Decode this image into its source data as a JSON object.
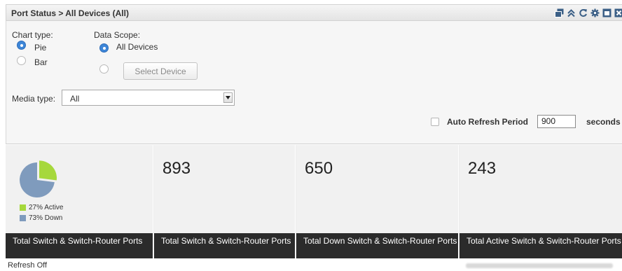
{
  "header": {
    "title": "Port Status > All Devices (All)",
    "tools": [
      {
        "icon": "copy-icon"
      },
      {
        "icon": "collapse-up-icon"
      },
      {
        "icon": "refresh-icon"
      },
      {
        "icon": "gear-icon"
      },
      {
        "icon": "maximize-icon"
      },
      {
        "icon": "close-icon"
      }
    ],
    "tool_color": "#3b5f86"
  },
  "options": {
    "chart_type_label": "Chart type:",
    "chart_types": [
      {
        "label": "Pie",
        "selected": true
      },
      {
        "label": "Bar",
        "selected": false
      }
    ],
    "data_scope_label": "Data Scope:",
    "data_scopes": [
      {
        "label": "All Devices",
        "selected": true
      },
      {
        "label": "",
        "selected": false
      }
    ],
    "select_device_label": "Select Device",
    "media_type_label": "Media type:",
    "media_type_value": "All",
    "auto_refresh_label": "Auto Refresh Period",
    "auto_refresh_checked": false,
    "auto_refresh_value": "900",
    "seconds_label": "seconds"
  },
  "pie": {
    "slices": [
      {
        "label": "27% Active",
        "percent": 27,
        "color": "#a6d83c"
      },
      {
        "label": "73% Down",
        "percent": 73,
        "color": "#7f9bbd"
      }
    ],
    "caption": "Total Switch & Switch-Router Ports"
  },
  "tiles": [
    {
      "value": "893",
      "caption": "Total Switch & Switch-Router Ports"
    },
    {
      "value": "650",
      "caption": "Total Down Switch & Switch-Router Ports"
    },
    {
      "value": "243",
      "caption": "Total Active Switch & Switch-Router Ports"
    }
  ],
  "status": {
    "refresh": "Refresh Off"
  }
}
